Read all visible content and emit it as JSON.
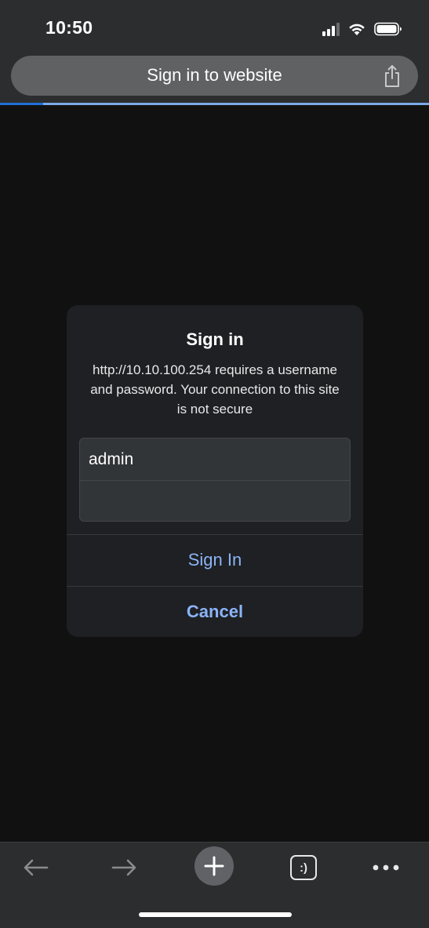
{
  "status_bar": {
    "time": "10:50",
    "signal_icon": "cellular-signal-icon",
    "wifi_icon": "wifi-icon",
    "battery_icon": "battery-icon"
  },
  "browser": {
    "address_title": "Sign in to website",
    "share_icon": "share-icon",
    "load_progress": 0.1,
    "colors": {
      "chrome": "#2c2d2f",
      "page": "#111111",
      "accent": "#8ab4f8",
      "progress": "#1f6fd8"
    }
  },
  "dialog": {
    "title": "Sign in",
    "message": "http://10.10.100.254 requires a username and password. Your connection to this site is not secure",
    "username_value": "admin",
    "password_value": "",
    "sign_in_label": "Sign In",
    "cancel_label": "Cancel"
  },
  "toolbar": {
    "back_icon": "back-arrow-icon",
    "forward_icon": "forward-arrow-icon",
    "new_tab_icon": "plus-icon",
    "tab_switcher_label": ":)",
    "more_icon": "more-dots-icon"
  }
}
